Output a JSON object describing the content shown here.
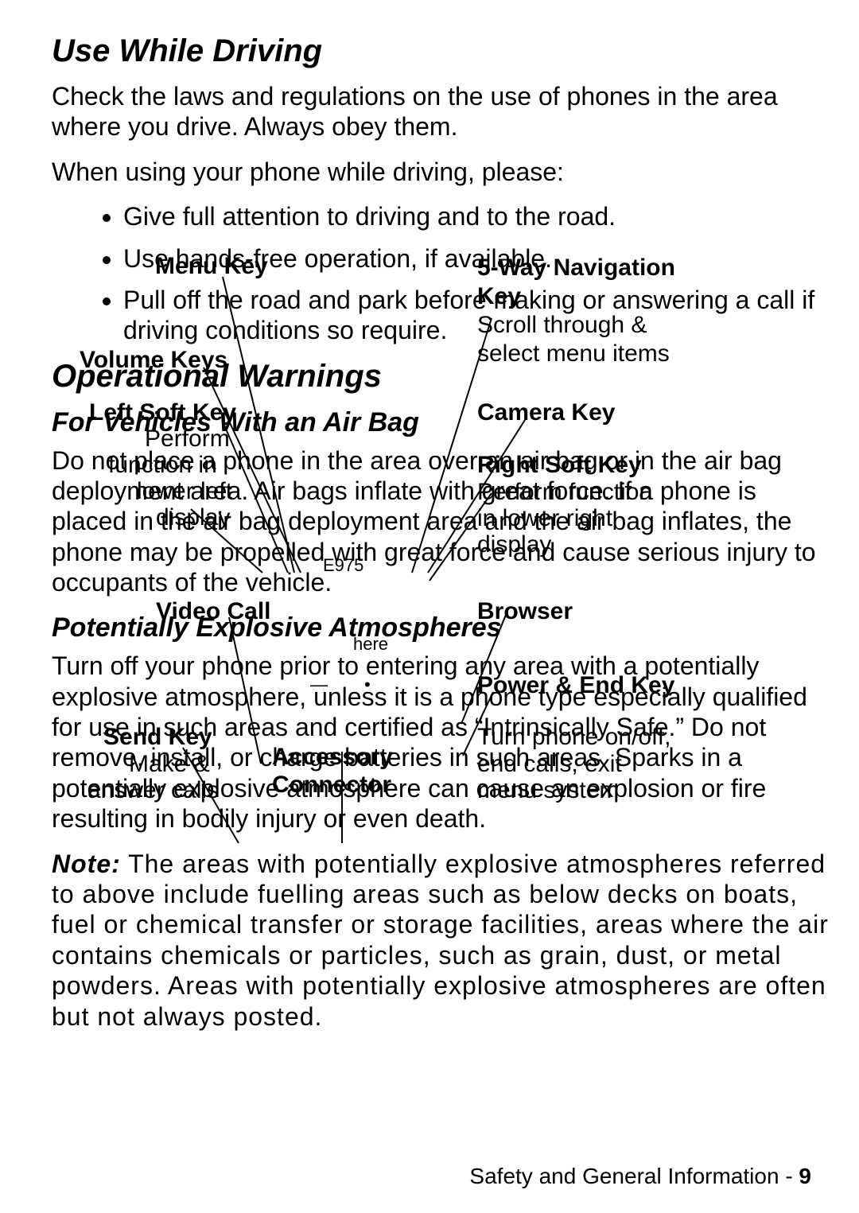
{
  "content": {
    "h_use_while_driving": "Use While Driving",
    "p_check_laws": "Check the laws and regulations on the use of phones in the area where you drive. Always obey them.",
    "p_when_using": "When using your phone while driving, please:",
    "bullets": [
      "Give full attention to driving and to the road.",
      "Use hands-free operation, if available.",
      "Pull off the road and park before making or answering a call if driving conditions so require."
    ],
    "h_op_warnings": "Operational Warnings",
    "h_airbag": "For Vehicles With an Air Bag",
    "p_airbag": "Do not place a phone in the area over an air bag or in the air bag deployment area. Air bags inflate with great force. If a phone is placed in the air bag deployment area and the air bag inflates, the phone may be propelled with great force and cause serious injury to occupants of the vehicle.",
    "h_pea": "Potentially Explosive Atmospheres",
    "p_pea": "Turn off your phone prior to entering any area with a potentially explosive atmosphere, unless it is a phone type especially qualified for use in such areas and certified as “Intrinsically Safe.” Do not remove, install, or charge batteries in such areas. Sparks in a potentially explosive atmosphere can cause an explosion or fire resulting in bodily injury or even death.",
    "note_label": "Note:",
    "p_note": " The areas with potentially explosive atmospheres referred to above include fuelling areas such as below decks on boats, fuel or chemical transfer or storage facilities, areas where the air contains chemicals or particles, such as grain, dust, or metal powders. Areas with potentially explosive atmospheres are often but not always posted."
  },
  "footer": {
    "label": "Safety and General Information - ",
    "page": "9"
  },
  "overlay": {
    "menu_key": "Menu Key",
    "volume_keys": "Volume Keys",
    "left_soft_key_t": "Left Soft Key",
    "left_soft_key_d1": "Perform",
    "left_soft_key_d2": "function in",
    "left_soft_key_d3": "lower left",
    "left_soft_key_d4": "display",
    "video_call": "Video Call",
    "send_key_t": "Send Key",
    "send_key_d1": "Make &",
    "send_key_d2": "answer calls",
    "five_way_t": "5-Way Navigation",
    "five_way_t2": "Key",
    "five_way_d1": "Scroll through &",
    "five_way_d2": "select menu items",
    "camera_key": "Camera Key",
    "right_soft_key_t": "Right Soft Key",
    "right_soft_key_d1": "Perform function",
    "right_soft_key_d2": "in lower right",
    "right_soft_key_d3": "display",
    "browser": "Browser",
    "power_end_t": "Power & End Key",
    "power_end_d1": "Turn phone on/off,",
    "power_end_d2": "end calls, exit",
    "power_end_d3": "menu system",
    "accessory_t": "Accessory",
    "accessory_t2": "Connector"
  },
  "micro": {
    "e975": "E975",
    "here": "here",
    "dash": "—",
    "dot": "•"
  }
}
